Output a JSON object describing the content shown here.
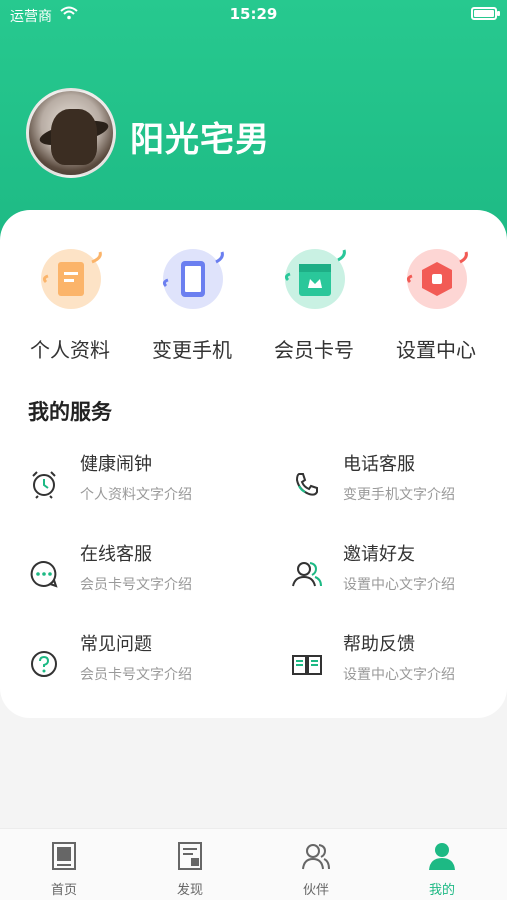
{
  "status_bar": {
    "carrier": "运营商",
    "time": "15:29"
  },
  "profile": {
    "username": "阳光宅男"
  },
  "quick_actions": [
    {
      "label": "个人资料",
      "icon": "profile-doc-icon",
      "color": "#fbb46a"
    },
    {
      "label": "变更手机",
      "icon": "phone-change-icon",
      "color": "#6b7ff0"
    },
    {
      "label": "会员卡号",
      "icon": "member-card-icon",
      "color": "#2ac79a"
    },
    {
      "label": "设置中心",
      "icon": "settings-hex-icon",
      "color": "#f25b55"
    }
  ],
  "services": {
    "title": "我的服务",
    "items": [
      {
        "title": "健康闹钟",
        "desc": "个人资料文字介绍",
        "icon": "alarm-clock-icon"
      },
      {
        "title": "电话客服",
        "desc": "变更手机文字介绍",
        "icon": "phone-icon"
      },
      {
        "title": "在线客服",
        "desc": "会员卡号文字介绍",
        "icon": "chat-bubble-icon"
      },
      {
        "title": "邀请好友",
        "desc": "设置中心文字介绍",
        "icon": "invite-friends-icon"
      },
      {
        "title": "常见问题",
        "desc": "会员卡号文字介绍",
        "icon": "question-icon"
      },
      {
        "title": "帮助反馈",
        "desc": "设置中心文字介绍",
        "icon": "book-icon"
      }
    ]
  },
  "tabbar": {
    "active_color": "#1db984",
    "items": [
      {
        "label": "首页",
        "icon": "home-book-icon"
      },
      {
        "label": "发现",
        "icon": "discover-doc-icon"
      },
      {
        "label": "伙伴",
        "icon": "partners-icon"
      },
      {
        "label": "我的",
        "icon": "me-user-icon",
        "active": true
      }
    ]
  }
}
